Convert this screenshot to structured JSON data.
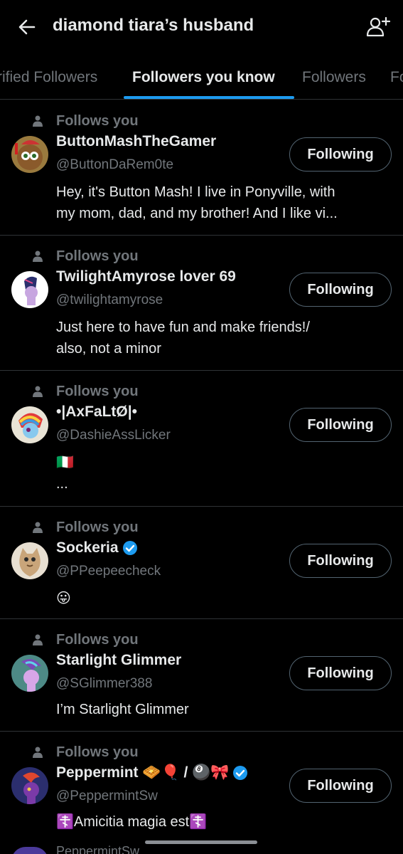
{
  "header": {
    "back_icon": "arrow-left-icon",
    "title": "diamond tiara’s husband",
    "add_icon": "add-user-icon"
  },
  "tabs": [
    {
      "label": "rified Followers",
      "active": false
    },
    {
      "label": "Followers you know",
      "active": true
    },
    {
      "label": "Followers",
      "active": false
    },
    {
      "label": "Fo",
      "active": false
    }
  ],
  "accent_color": "#1d9bf0",
  "users": [
    {
      "follows_label": "Follows you",
      "name": "ButtonMashTheGamer",
      "handle": "@ButtonDaRem0te",
      "bio_lines": [
        "Hey, it's Button Mash! I live in Ponyville, with",
        "my mom, dad, and my brother! And I like vi..."
      ],
      "button": "Following",
      "verified": false
    },
    {
      "follows_label": "Follows you",
      "name": "TwilightAmyrose lover 69",
      "handle": "@twilightamyrose",
      "bio_lines": [
        "Just here to have fun and make friends!/",
        "also, not a minor"
      ],
      "button": "Following",
      "verified": false
    },
    {
      "follows_label": "Follows you",
      "name": "•|AxFaLtØ|•",
      "handle": "@DashieAssLicker",
      "bio_lines": [
        "🇮🇹",
        "..."
      ],
      "button": "Following",
      "verified": false
    },
    {
      "follows_label": "Follows you",
      "name": "Sockeria",
      "handle": "@PPeepeecheck",
      "bio_lines": [
        "😛"
      ],
      "button": "Following",
      "verified": true
    },
    {
      "follows_label": "Follows you",
      "name": "Starlight Glimmer",
      "handle": "@SGlimmer388",
      "bio_lines": [
        "I’m Starlight Glimmer"
      ],
      "button": "Following",
      "verified": false
    },
    {
      "follows_label": "Follows you",
      "name": "Peppermint 🧇🎈 / 🎱🎀",
      "handle": "@PeppermintSw",
      "bio_lines": [
        "☦️Amicitia magia est☦️"
      ],
      "button": "Following",
      "verified": true
    }
  ],
  "peek": {
    "text": "PeppermintSw"
  }
}
